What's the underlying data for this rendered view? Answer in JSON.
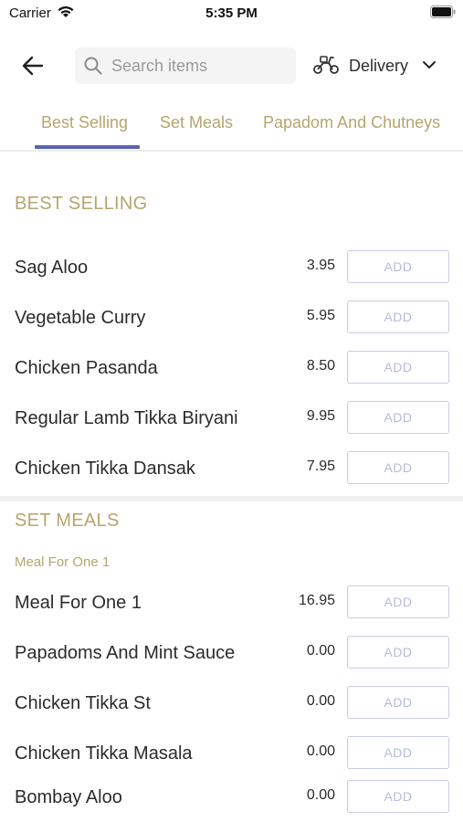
{
  "status_bar": {
    "carrier": "Carrier",
    "time": "5:35 PM"
  },
  "header": {
    "search": {
      "placeholder": "Search items"
    },
    "delivery": {
      "label": "Delivery"
    }
  },
  "tabs": [
    {
      "label": "Best Selling",
      "active": true
    },
    {
      "label": "Set Meals",
      "active": false
    },
    {
      "label": "Papadom And Chutneys",
      "active": false
    }
  ],
  "sections": {
    "best_selling": {
      "title": "BEST SELLING",
      "items": [
        {
          "name": "Sag Aloo",
          "price": "3.95",
          "button": "ADD"
        },
        {
          "name": "Vegetable Curry",
          "price": "5.95",
          "button": "ADD"
        },
        {
          "name": "Chicken Pasanda",
          "price": "8.50",
          "button": "ADD"
        },
        {
          "name": "Regular Lamb Tikka Biryani",
          "price": "9.95",
          "button": "ADD"
        },
        {
          "name": "Chicken Tikka Dansak",
          "price": "7.95",
          "button": "ADD"
        }
      ]
    },
    "set_meals": {
      "title": "SET MEALS",
      "subcategory": "Meal For One 1",
      "items": [
        {
          "name": "Meal For One 1",
          "price": "16.95",
          "button": "ADD"
        },
        {
          "name": "Papadoms And Mint Sauce",
          "price": "0.00",
          "button": "ADD"
        },
        {
          "name": "Chicken Tikka St",
          "price": "0.00",
          "button": "ADD"
        },
        {
          "name": "Chicken Tikka Masala",
          "price": "0.00",
          "button": "ADD"
        },
        {
          "name": "Bombay Aloo",
          "price": "0.00",
          "button": "ADD"
        }
      ]
    }
  },
  "colors": {
    "accent_gold": "#b6a56e",
    "tab_indicator": "#5b62b2",
    "add_button_border": "#c9cce8",
    "add_button_text": "#b6badf"
  }
}
